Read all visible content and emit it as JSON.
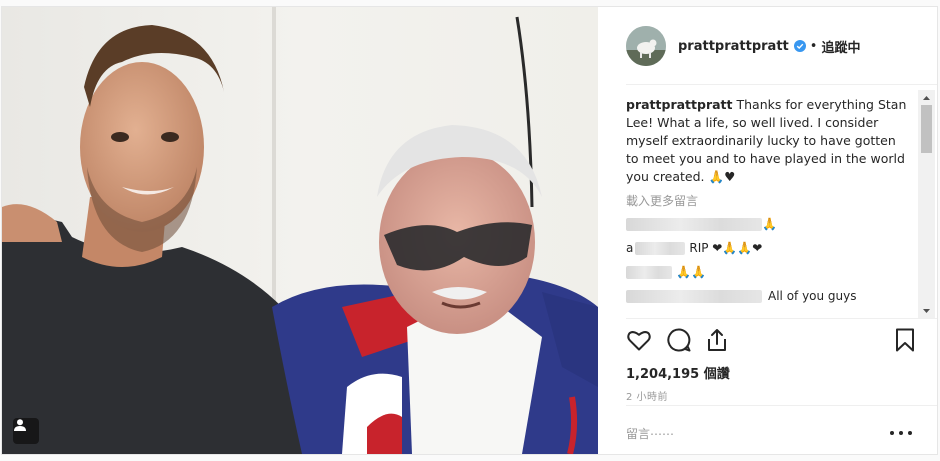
{
  "post": {
    "username": "prattprattpratt",
    "follow_status": "追蹤中",
    "separator": "•",
    "caption_text": "Thanks for everything Stan Lee! What a life, so well lived. I consider myself extraordinarily lucky to have gotten to meet you and to have played in the world you created. 🙏♥",
    "load_more": "載入更多留言",
    "comments": [
      {
        "text": "🙏"
      },
      {
        "text": "RIP ❤🙏🙏❤"
      },
      {
        "text": "🙏🙏"
      },
      {
        "text": "All of you guys"
      }
    ],
    "views": "1,204,195 個讚",
    "time_ago": "2 小時前",
    "add_comment_placeholder": "留言⋯⋯"
  },
  "icons": {
    "verified": "verified-badge-icon",
    "like": "heart-icon",
    "comment": "comment-bubble-icon",
    "share": "share-icon",
    "save": "bookmark-icon",
    "tag": "user-tag-icon",
    "more": "more-options-icon"
  },
  "colors": {
    "verified": "#3897f0",
    "text": "#262626",
    "muted": "#999999",
    "border": "#efefef"
  }
}
